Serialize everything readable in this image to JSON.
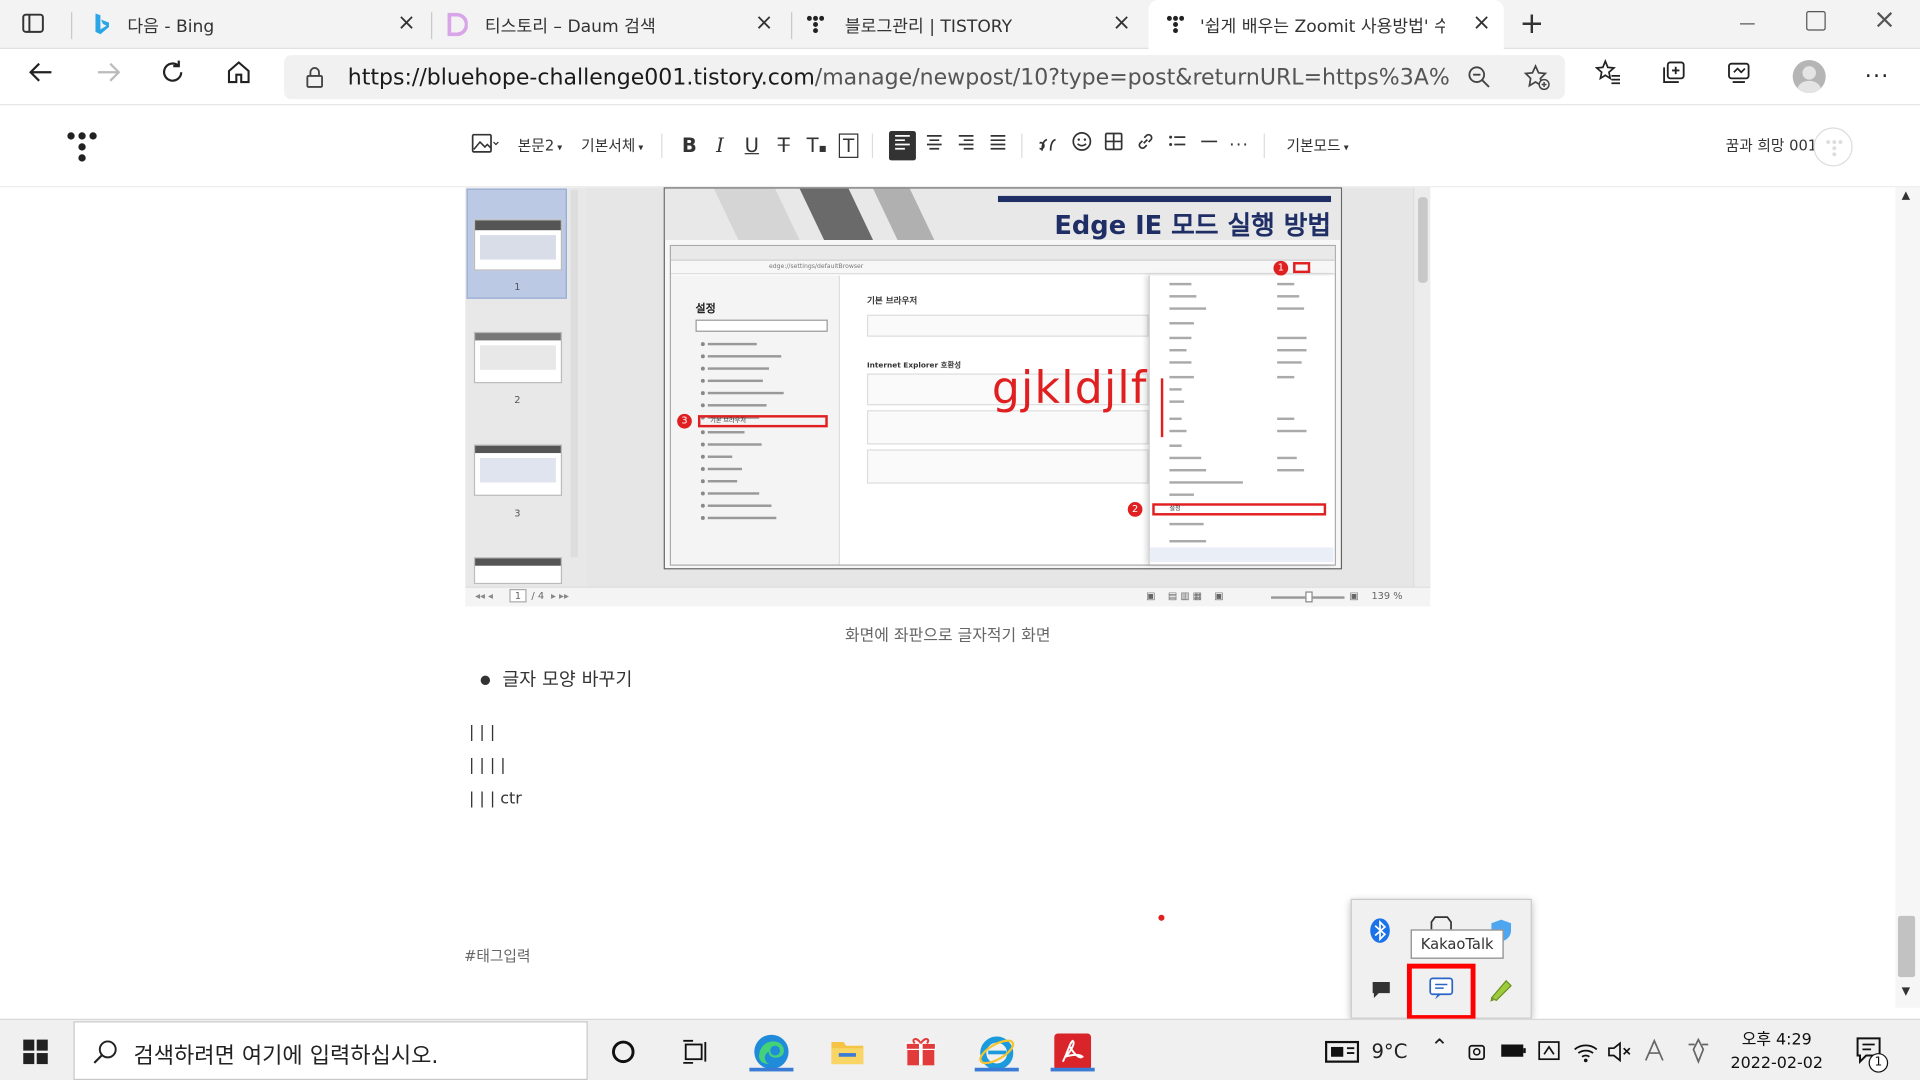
{
  "tabs": [
    {
      "title": "다음 - Bing"
    },
    {
      "title": "티스토리 – Daum 검색"
    },
    {
      "title": "블로그관리 | TISTORY"
    },
    {
      "title": "'쉽게 배우는 Zoomit 사용방법' 수"
    }
  ],
  "address": {
    "url_host": "https://bluehope-challenge001.tistory.com",
    "url_rest": "/manage/newpost/10?type=post&returnURL=https%3A%2F%2Fbluehope..."
  },
  "toolbar": {
    "paragraph_style": "본문2",
    "font": "기본서체",
    "mode": "기본모드",
    "user": "꿈과 희망 001"
  },
  "screenshot": {
    "slide_title": "Edge IE 모드 실행 방법",
    "settings_heading": "설정",
    "default_browser_heading": "기본 브라우저",
    "ie_compat_heading": "Internet Explorer 호환성",
    "default_browser_item": "기본 브라우저",
    "annotation": "gjkldjlf",
    "menu_settings": "설정",
    "page_indicator": "1",
    "page_total": "/ 4",
    "zoom": "139 %",
    "thumb_labels": [
      "1",
      "2",
      "3"
    ]
  },
  "post": {
    "caption": "화면에 좌판으로 글자적기 화면",
    "bullet": "글자 모양 바꾸기",
    "lines": [
      "| | |",
      "| | | |",
      "| | | ctr"
    ],
    "tag_placeholder": "#태그입력"
  },
  "tray": {
    "tooltip": "KakaoTalk"
  },
  "taskbar": {
    "search_placeholder": "검색하려면 여기에 입력하십시오.",
    "temperature": "9°C",
    "time": "오후 4:29",
    "date": "2022-02-02",
    "notifications": "1"
  },
  "colors": {
    "highlight_red": "#e02020",
    "accent_blue": "#3a7bd5",
    "toolbar_active": "#333333"
  }
}
